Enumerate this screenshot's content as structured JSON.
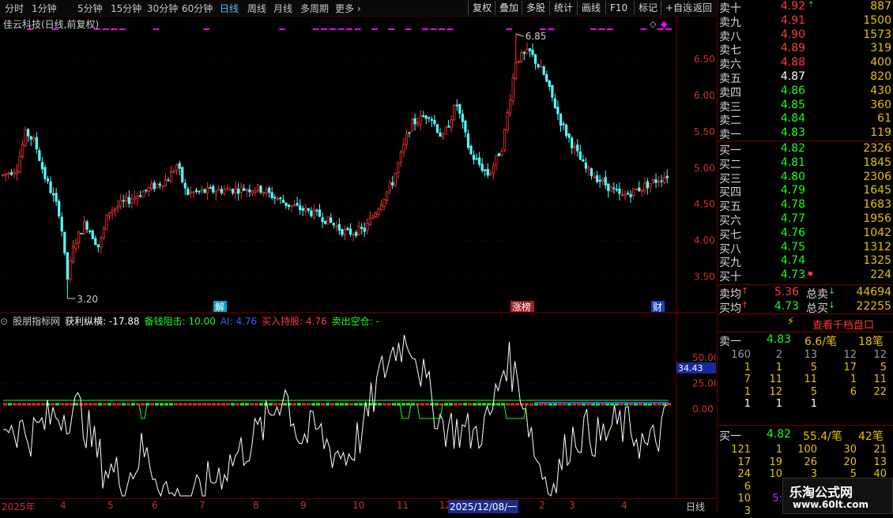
{
  "toolbar": {
    "periods": [
      "分时",
      "1分钟",
      "5分钟",
      "15分钟",
      "30分钟",
      "60分钟",
      "日线",
      "周线",
      "月线",
      "多周期",
      "更多"
    ],
    "active_period": "日线",
    "buttons": [
      "复权",
      "叠加",
      "多股",
      "统计",
      "画线",
      "F10",
      "标记",
      "+自选",
      "返回"
    ]
  },
  "stock": {
    "title": "佳云科技(日线,前复权)"
  },
  "price_axis": {
    "labels": [
      "6.50",
      "6.00",
      "5.50",
      "5.00",
      "4.50",
      "4.00",
      "3.50"
    ],
    "values": [
      6.5,
      6.0,
      5.5,
      5.0,
      4.5,
      4.0,
      3.5
    ]
  },
  "annotations": {
    "high": "6.85",
    "low": "3.20",
    "tags": [
      "解",
      "涨榜",
      "财"
    ]
  },
  "indicator": {
    "name": "股朋指标网",
    "items": [
      {
        "label": "获利纵横: -17.88",
        "color": "#ffffff"
      },
      {
        "label": "备钱阻击: 10.00",
        "color": "#19ff19"
      },
      {
        "label": "AI: 4.76",
        "color": "#3060ff"
      },
      {
        "label": "买入持股: 4.76",
        "color": "#ff3b3b"
      },
      {
        "label": "卖出空仓: -",
        "color": "#19ff19"
      }
    ],
    "axis_labels": [
      "50.00",
      "25.00",
      "0.00"
    ],
    "axis_values": [
      50,
      25,
      0
    ],
    "current_value": "34.43"
  },
  "dates": {
    "labels": [
      "2025年",
      "4",
      "5",
      "6",
      "7",
      "8",
      "9",
      "10",
      "11",
      "12",
      "2025/12/08/一",
      "2",
      "3",
      "4"
    ],
    "period_label": "日线"
  },
  "orderbook": {
    "asks": [
      {
        "label": "卖十",
        "price": "4.92",
        "mark": "⇡",
        "volume": "887"
      },
      {
        "label": "卖九",
        "price": "4.91",
        "volume": "1500"
      },
      {
        "label": "卖八",
        "price": "4.90",
        "volume": "1573"
      },
      {
        "label": "卖七",
        "price": "4.89",
        "volume": "319"
      },
      {
        "label": "卖六",
        "price": "4.88",
        "volume": "400"
      },
      {
        "label": "卖五",
        "price": "4.87",
        "volume": "820"
      },
      {
        "label": "卖四",
        "price": "4.86",
        "volume": "430"
      },
      {
        "label": "卖三",
        "price": "4.85",
        "volume": "360"
      },
      {
        "label": "卖二",
        "price": "4.84",
        "volume": "61"
      },
      {
        "label": "卖一",
        "price": "4.83",
        "volume": "119"
      }
    ],
    "bids": [
      {
        "label": "买一",
        "price": "4.82",
        "volume": "2326"
      },
      {
        "label": "买二",
        "price": "4.81",
        "volume": "1845"
      },
      {
        "label": "买三",
        "price": "4.80",
        "volume": "2306"
      },
      {
        "label": "买四",
        "price": "4.79",
        "volume": "1645"
      },
      {
        "label": "买五",
        "price": "4.78",
        "volume": "1683"
      },
      {
        "label": "买六",
        "price": "4.77",
        "volume": "1956"
      },
      {
        "label": "买七",
        "price": "4.76",
        "volume": "1042"
      },
      {
        "label": "买八",
        "price": "4.75",
        "volume": "1312"
      },
      {
        "label": "买九",
        "price": "4.74",
        "volume": "1325"
      },
      {
        "label": "买十",
        "price": "4.73",
        "mark": "▪",
        "volume": "224"
      }
    ],
    "avg_sell": {
      "label": "卖均",
      "price": "5.36",
      "total_label": "总卖",
      "total": "44694"
    },
    "avg_buy": {
      "label": "买均",
      "price": "4.73",
      "total_label": "总买",
      "total": "22255"
    }
  },
  "thousand": {
    "label": "查看千档盘口"
  },
  "queue": {
    "sell_head": {
      "label": "卖一",
      "price": "4.83",
      "per": "6.6/笔",
      "count": "18笔"
    },
    "sell_rows": [
      [
        "160",
        "2",
        "13",
        "12",
        "12"
      ],
      [
        "1",
        "1",
        "5",
        "17",
        "5"
      ],
      [
        "7",
        "11",
        "11",
        "1",
        "11"
      ],
      [
        "1",
        "12",
        "5",
        "6",
        "22"
      ],
      [
        "1",
        "1",
        "1",
        "",
        ""
      ]
    ],
    "buy_head": {
      "label": "买一",
      "price": "4.82",
      "per": "55.4/笔",
      "count": "42笔"
    },
    "buy_rows": [
      [
        "121",
        "1",
        "100",
        "30",
        "21"
      ],
      [
        "17",
        "19",
        "26",
        "20",
        "13"
      ],
      [
        "24",
        "10",
        "3",
        "5",
        "40"
      ],
      [
        "6",
        "",
        "",
        "",
        ""
      ],
      [
        "10",
        "5:",
        "",
        "",
        ""
      ],
      [
        "3",
        "",
        "",
        "",
        ""
      ]
    ]
  },
  "watermark": {
    "title": "乐淘公式网",
    "url": "www.60lt.com"
  }
}
